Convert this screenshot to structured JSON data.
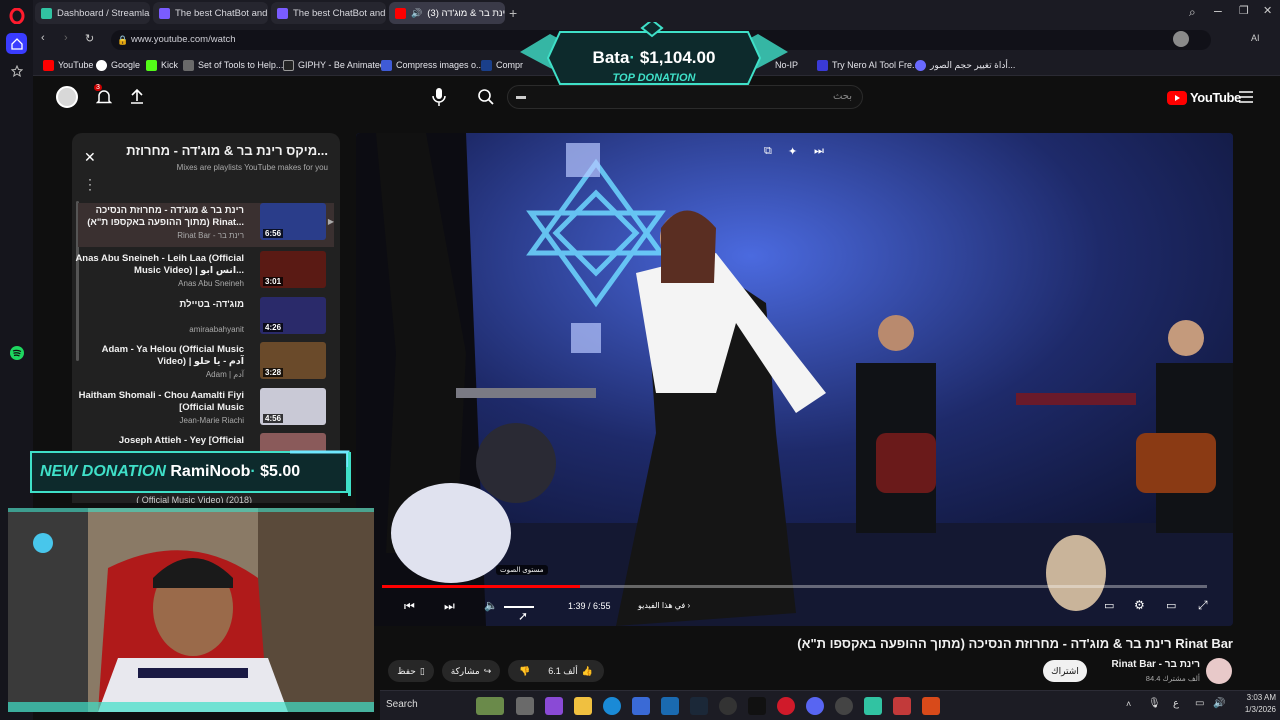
{
  "browser": {
    "tabs": [
      {
        "label": "Dashboard / Streamlabs"
      },
      {
        "label": "The best ChatBot and Wid"
      },
      {
        "label": "The best ChatBot and Wid"
      },
      {
        "label": "רינת בר & מוג'דה (3)"
      }
    ],
    "url": "www.youtube.com/watch",
    "bookmarks": [
      "YouTube",
      "Google",
      "Kick",
      "Set of Tools to Help...",
      "GIPHY - Be Animated",
      "Compress images o...",
      "Compr",
      "No-IP",
      "Try Nero AI Tool Fre...",
      "أداة تغيير حجم الصور..."
    ],
    "right_label": "AI"
  },
  "youtube": {
    "logo": "YouTube",
    "notif_count": "3",
    "search_placeholder": "بحث",
    "search_text": "▬"
  },
  "playlist": {
    "title": "מיקס רינת בר & מוג'דה - מחרוזת...",
    "subtitle": "Mixes are playlists YouTube makes for you",
    "items": [
      {
        "title": "רינת בר & מוג'דה - מחרוזת הנסיכה (מתוך ההופעה באקספו ת\"א) Rinat...",
        "channel": "Rinat Bar - רינת בר",
        "duration": "6:56",
        "thumb": "#2a3d8a"
      },
      {
        "title": "Anas Abu Sneineh - Leih Laa (Official Music Video) | انس ابو...",
        "channel": "Anas Abu Sneineh",
        "duration": "3:01",
        "thumb": "#5a1a14"
      },
      {
        "title": "מוג'דה- בטיילת",
        "channel": "amiraabahyanit",
        "duration": "4:26",
        "thumb": "#2a2a6a"
      },
      {
        "title": "Adam - Ya Helou (Official Music Video) | آدم - يا حلو",
        "channel": "Adam | آدم",
        "duration": "3:28",
        "thumb": "#6a4a2a"
      },
      {
        "title": "Haitham Shomali - Chou Aamalti Fiyi [Official Music",
        "channel": "Jean-Marie Riachi",
        "duration": "4:56",
        "thumb": "#c9c9d6"
      },
      {
        "title": "Joseph Attieh - Yey [Official",
        "channel": "",
        "duration": "",
        "thumb": "#8a5a5a"
      }
    ],
    "hidden_tail": "( Official Music Video) (2018)"
  },
  "video": {
    "time": "1:39 / 6:55",
    "chapter": "في هذا الفيديو",
    "volume_tooltip": "مستوى الصوت",
    "progress": 0.24
  },
  "below": {
    "title": "רינת בר & מוג'דה - מחרוזת הנסיכה (מתוך ההופעה באקספו ת\"א) Rinat Bar",
    "channel": "Rinat Bar - רינת בר",
    "subscribers": "84.4 ألف مشترك",
    "subscribe": "اشتراك",
    "likes": "6.1 ألف",
    "share": "مشاركة",
    "save": "حفظ"
  },
  "overlays": {
    "top_donation_name": "Bata",
    "top_donation_amount": "$1,104.00",
    "top_donation_label": "TOP DONATION",
    "new_donation_label": "NEW DONATION",
    "new_donation_name": "RamiNoob",
    "new_donation_amount": "$5.00"
  },
  "taskbar": {
    "search": "Search",
    "time": "3:03 AM",
    "date": "1/3/2026",
    "lang": "ع"
  },
  "colors": {
    "accent_red": "#ff0000",
    "donation_cyan": "#3fe0c8",
    "donation_panel": "#0d2a2c"
  }
}
